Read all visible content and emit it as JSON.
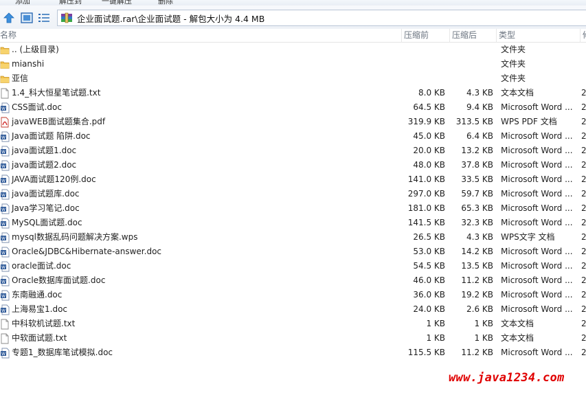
{
  "toolbar": {
    "buttons": [
      "添加",
      "解压到",
      "一键解压",
      "删除"
    ]
  },
  "address": {
    "path": "企业面试题.rar\\企业面试题 - 解包大小为 4.4 MB"
  },
  "columns": {
    "name": "名称",
    "size": "压缩前",
    "packed": "压缩后",
    "type": "类型",
    "extra": "修"
  },
  "files": [
    {
      "name": ".. (上级目录)",
      "size": "",
      "packed": "",
      "type": "文件夹",
      "icon": "folder-icon",
      "extra": ""
    },
    {
      "name": "mianshi",
      "size": "",
      "packed": "",
      "type": "文件夹",
      "icon": "folder-icon",
      "extra": ""
    },
    {
      "name": "亚信",
      "size": "",
      "packed": "",
      "type": "文件夹",
      "icon": "folder-icon",
      "extra": ""
    },
    {
      "name": "1.4_科大恒星笔试题.txt",
      "size": "8.0 KB",
      "packed": "4.3 KB",
      "type": "文本文档",
      "icon": "text-file-icon",
      "extra": "2"
    },
    {
      "name": "CSS面试.doc",
      "size": "64.5 KB",
      "packed": "9.4 KB",
      "type": "Microsoft Word ...",
      "icon": "word-doc-icon",
      "extra": "2"
    },
    {
      "name": "javaWEB面试题集合.pdf",
      "size": "319.9 KB",
      "packed": "313.5 KB",
      "type": "WPS PDF 文档",
      "icon": "pdf-icon",
      "extra": "2"
    },
    {
      "name": "Java面试题  陷阱.doc",
      "size": "45.0 KB",
      "packed": "6.4 KB",
      "type": "Microsoft Word ...",
      "icon": "word-doc-icon",
      "extra": "2"
    },
    {
      "name": "java面试题1.doc",
      "size": "20.0 KB",
      "packed": "13.2 KB",
      "type": "Microsoft Word ...",
      "icon": "word-doc-icon",
      "extra": "2"
    },
    {
      "name": "java面试题2.doc",
      "size": "48.0 KB",
      "packed": "37.8 KB",
      "type": "Microsoft Word ...",
      "icon": "word-doc-icon",
      "extra": "2"
    },
    {
      "name": "JAVA面试题120例.doc",
      "size": "141.0 KB",
      "packed": "33.5 KB",
      "type": "Microsoft Word ...",
      "icon": "word-doc-icon",
      "extra": "2"
    },
    {
      "name": "java面试题库.doc",
      "size": "297.0 KB",
      "packed": "59.7 KB",
      "type": "Microsoft Word ...",
      "icon": "word-doc-icon",
      "extra": "2"
    },
    {
      "name": "Java学习笔记.doc",
      "size": "181.0 KB",
      "packed": "65.3 KB",
      "type": "Microsoft Word ...",
      "icon": "word-doc-icon",
      "extra": "2"
    },
    {
      "name": "MySQL面试题.doc",
      "size": "141.5 KB",
      "packed": "32.3 KB",
      "type": "Microsoft Word ...",
      "icon": "word-doc-icon",
      "extra": "2"
    },
    {
      "name": "mysql数据乱码问题解决方案.wps",
      "size": "26.5 KB",
      "packed": "4.3 KB",
      "type": "WPS文字 文档",
      "icon": "word-doc-icon",
      "extra": "2"
    },
    {
      "name": "Oracle&JDBC&Hibernate-answer.doc",
      "size": "53.0 KB",
      "packed": "14.2 KB",
      "type": "Microsoft Word ...",
      "icon": "word-doc-icon",
      "extra": "2"
    },
    {
      "name": "oracle面试.doc",
      "size": "54.5 KB",
      "packed": "13.5 KB",
      "type": "Microsoft Word ...",
      "icon": "word-doc-icon",
      "extra": "2"
    },
    {
      "name": "Oracle数据库面试题.doc",
      "size": "46.0 KB",
      "packed": "11.2 KB",
      "type": "Microsoft Word ...",
      "icon": "word-doc-icon",
      "extra": "2"
    },
    {
      "name": "东南融通.doc",
      "size": "36.0 KB",
      "packed": "19.2 KB",
      "type": "Microsoft Word ...",
      "icon": "word-doc-icon",
      "extra": "2"
    },
    {
      "name": "上海易宝1.doc",
      "size": "24.0 KB",
      "packed": "2.6 KB",
      "type": "Microsoft Word ...",
      "icon": "word-doc-icon",
      "extra": "2"
    },
    {
      "name": "中科软机试题.txt",
      "size": "1 KB",
      "packed": "1 KB",
      "type": "文本文档",
      "icon": "text-file-icon",
      "extra": "2"
    },
    {
      "name": "中软面试题.txt",
      "size": "1 KB",
      "packed": "1 KB",
      "type": "文本文档",
      "icon": "text-file-icon",
      "extra": "2"
    },
    {
      "name": "专题1_数据库笔试模拟.doc",
      "size": "115.5 KB",
      "packed": "11.2 KB",
      "type": "Microsoft Word ...",
      "icon": "word-doc-icon",
      "extra": "2"
    }
  ],
  "watermark": "www.java1234.com",
  "colors": {
    "folder": "#e8b23a",
    "word": "#2b5797",
    "pdf": "#d32f2f",
    "watermark": "#e00000"
  }
}
